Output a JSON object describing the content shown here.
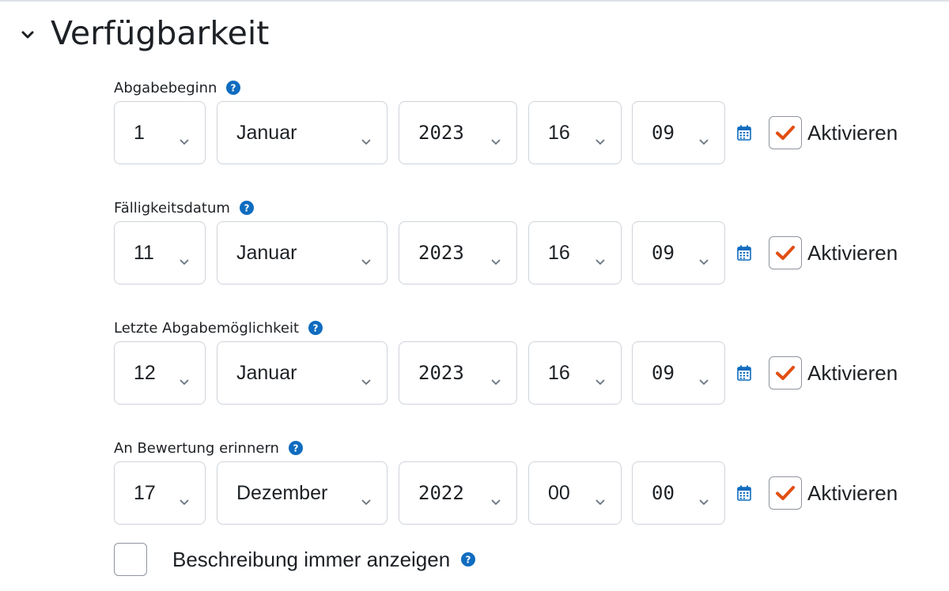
{
  "section": {
    "title": "Verfügbarkeit",
    "icon": "chevron-down-icon"
  },
  "fields": [
    {
      "label": "Abgabebeginn",
      "day": "1",
      "month": "Januar",
      "year": "2023",
      "hour": "16",
      "minute": "09",
      "enabled": true,
      "enable_label": "Aktivieren"
    },
    {
      "label": "Fälligkeitsdatum",
      "day": "11",
      "month": "Januar",
      "year": "2023",
      "hour": "16",
      "minute": "09",
      "enabled": true,
      "enable_label": "Aktivieren"
    },
    {
      "label": "Letzte Abgabemöglichkeit",
      "day": "12",
      "month": "Januar",
      "year": "2023",
      "hour": "16",
      "minute": "09",
      "enabled": true,
      "enable_label": "Aktivieren"
    },
    {
      "label": "An Bewertung erinnern",
      "day": "17",
      "month": "Dezember",
      "year": "2022",
      "hour": "00",
      "minute": "00",
      "enabled": true,
      "enable_label": "Aktivieren"
    }
  ],
  "always_show_description": {
    "label": "Beschreibung immer anzeigen",
    "checked": false
  },
  "colors": {
    "help": "#0f6cbf",
    "checkmark": "#e24e12",
    "calendar": "#0f6cbf",
    "border": "#ced4da",
    "text": "#1d2125"
  }
}
